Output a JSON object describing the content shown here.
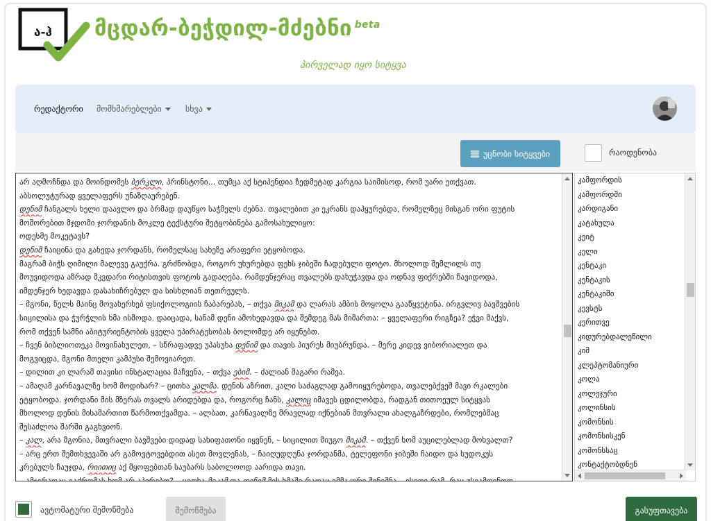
{
  "brand": {
    "logo_text": "ა-ჰ",
    "title": "მცდარ-ბეჭდილ-მძებნი",
    "beta": "beta",
    "subtitle": "პირველად იყო სიტყვა",
    "accent_color": "#7cb342"
  },
  "nav": {
    "items": [
      {
        "label": "რედაქტორი",
        "active": true
      },
      {
        "label": "მომხმარებლები",
        "dropdown": true
      },
      {
        "label": "სხვა",
        "dropdown": true
      }
    ],
    "avatar_icon": "user-avatar"
  },
  "toolbar": {
    "unknown_words_label": "უცნობი სიტყვები",
    "unknown_words_icon": "list-lines-icon",
    "count_label": "რაოდენობა"
  },
  "editor": {
    "lines": [
      [
        {
          "t": "არ აღმოჩნდა და მოინდომეს "
        },
        {
          "t": "ბერკლი",
          "err": true
        },
        {
          "t": ", პრინსტონი... თუმცა აქ სტიპენდია ზედმეტად კარგია საიმისოდ, რომ უარი ეთქვათ."
        }
      ],
      [
        {
          "t": "აბსოლუტურად ყველაფერს უნაზღაურებენ."
        }
      ],
      [
        {
          "t": "დენიმ",
          "err": true
        },
        {
          "t": " ჩანგალს ხელი დაავლო და ბრმად დაუწყო საჭმელს ძებნა. თვალებით კი ეკრანს დაჰყურებდა, რომელზეც მისგან ორი ფუტის"
        }
      ],
      [
        {
          "t": "მოშორებით მჯდომი ჯორდანის მოკლე ტექსტური შეტყობინება გამოსახულიყო:"
        }
      ],
      [
        {
          "t": "ოდესმე მოკეტავს?"
        }
      ],
      [
        {
          "t": "დენიმ",
          "err": true
        },
        {
          "t": " ჩაიცინა და გახედა ჯორდანს, რომელსაც სახეზე არაფერი ეტყობოდა."
        }
      ],
      [
        {
          "t": "მაგრამ ბიჭს ღიმილი მალევე გაუქრა. გრძნობდა, როგორ უხურებდა ფეხს ჯიბეში ჩადებული ფოტო. მხოლოდ შემლილს თუ"
        }
      ],
      [
        {
          "t": "მოუვიდოდა აზრად მკვდარი რიტისთვის ფოტოს გადაღება. რამდენჯერაც თვალებს დახუჭავდა და ოდნავ ფიქრებში წავიდოდა,"
        }
      ],
      [
        {
          "t": "იმდენჯერ ხედავდა დასახიჩრებულ და სისხლიან თეთრეულს."
        }
      ],
      [
        {
          "t": "– მგონი, წელს მაინც მოვახერხებ ფსიქოლოგიის ჩაბარებას, – თქვა "
        },
        {
          "t": "მიკამ",
          "err": true
        },
        {
          "t": " და ლარას ამბის მოყოლა გააწყვეტინა. ირგვლივ ბავშვების"
        }
      ],
      [
        {
          "t": "სიცილისა და ჭურჭლის ხმა ისმოდა. დაიცადა, სანამ დენი ამოხედავდა და შემდეგ მას მიმართა: – ყველაფერი რიგზეა? ეჭვი მაქვს,"
        }
      ],
      [
        {
          "t": "რომ თქვენ სამნი აბიტურიენტობის ყველა უპირატესობას ბოლომდე არ იყენებთ."
        }
      ],
      [
        {
          "t": "– ჩვენ ბიბლიოთეკა მოვინახულეთ, – სწრაფადვე უპასუხა "
        },
        {
          "t": "დენიმ",
          "err": true
        },
        {
          "t": " და თავის პიურეს მიუბრუნდა. – მერე კიდევ ვიბორიალეთ და"
        }
      ],
      [
        {
          "t": "მოგვიცდა, მგონი მთელი კამპუსი შემოვიარეთ."
        }
      ],
      [
        {
          "t": "– დილით კი ლარამ თავისი ინსტალაცია მაჩვენა, – თქვა "
        },
        {
          "t": "ებიმ",
          "err": true
        },
        {
          "t": ". – ძალიან მაგარი რამეა."
        }
      ],
      [
        {
          "t": "– ამაღამ კარნავალზე ხომ მოდიხარ? – ცითხა "
        },
        {
          "t": "კალმა",
          "err": true
        },
        {
          "t": ". დენის აზრით, კალი საძაგლად გამოიყურებოდა, თვალებქვეშ მავი რკალები"
        }
      ],
      [
        {
          "t": "ეტყობოდა. ჯორდანი მის მზერას თვალს არიდებდა და, როგორც ჩანს, "
        },
        {
          "t": "კალიც",
          "err": true
        },
        {
          "t": " იმავეს ცდილობდა, რადგან თითოეულ სიტყვას"
        }
      ],
      [
        {
          "t": "მხოლოდ დენის მისამართით წარმოთქვამდა. – ალბათ, კარნავალზე მრავლად იქნებიან მთვრალი ახალგაზრდები, რომლებმაც"
        }
      ],
      [
        {
          "t": "შესაძლოა შარში გაგხვიონ."
        }
      ],
      [
        {
          "t": "– "
        },
        {
          "t": "კალ",
          "err": true
        },
        {
          "t": ", არა მგონია, მთვრალი ბავშვები დიდად სახიფათონი იყვნენ, – სიცილით მიუგო "
        },
        {
          "t": "მიკამ",
          "err": true
        },
        {
          "t": ". – თქვენ ხომ აუცილებლად მოხვალთ?"
        }
      ],
      [
        {
          "t": "– არც ერთ შემთხვევაში არ გამოვტოვებდით ასეთ მოვლენას, – ჩაიღუდღუნა ჯორდანმა, ტელეფონი ჯიბეში ჩაიდო და სუდოკუს"
        }
      ],
      [
        {
          "t": "კრებულს ჩაუჯდა, "
        },
        {
          "t": "რიითიც",
          "err": true
        },
        {
          "t": " აქ მყოფებთან საუბარს საბოლოოდ აარიდა თავი."
        }
      ],
      [
        {
          "t": "– ამჯერადაც გაქრომას ხომ არ აპირებთ? – ცითხა "
        },
        {
          "t": "მიკამ",
          "err": true
        },
        {
          "t": " და "
        },
        {
          "t": "დენიმ",
          "err": true
        },
        {
          "t": " მის ხმაში რაღაც ემმაკური შენიშნა – ისეთი რამ, რაც უსიამოვნოდ"
        }
      ]
    ]
  },
  "wordlist": {
    "items": [
      "კამფორდის",
      "კამფორდში",
      "კარდიგანი",
      "კატახულა",
      "კეიტ",
      "კელი",
      "კენტაკი",
      "კენტაკის",
      "კენტაკიში",
      "კევსტს",
      "კერითვე",
      "კიდურებდალეწილი",
      "კიმ",
      "კლეპტომანიური",
      "კოლა",
      "კოლეჯური",
      "კოლინსის",
      "კომონსის",
      "კომონსისკენ",
      "კომონსსაც",
      "კონტაქტობდნენ"
    ]
  },
  "footer": {
    "auto_check_label": "ავტომატური შემოწმება",
    "auto_check_on": true,
    "check_label": "შემოწმება",
    "clear_label": "გასუფთავება"
  },
  "colors": {
    "primary_button": "#5aa0be",
    "success_button": "#2e6b3e",
    "navbar_bg": "#e3eef8",
    "error_underline": "#e53935"
  }
}
